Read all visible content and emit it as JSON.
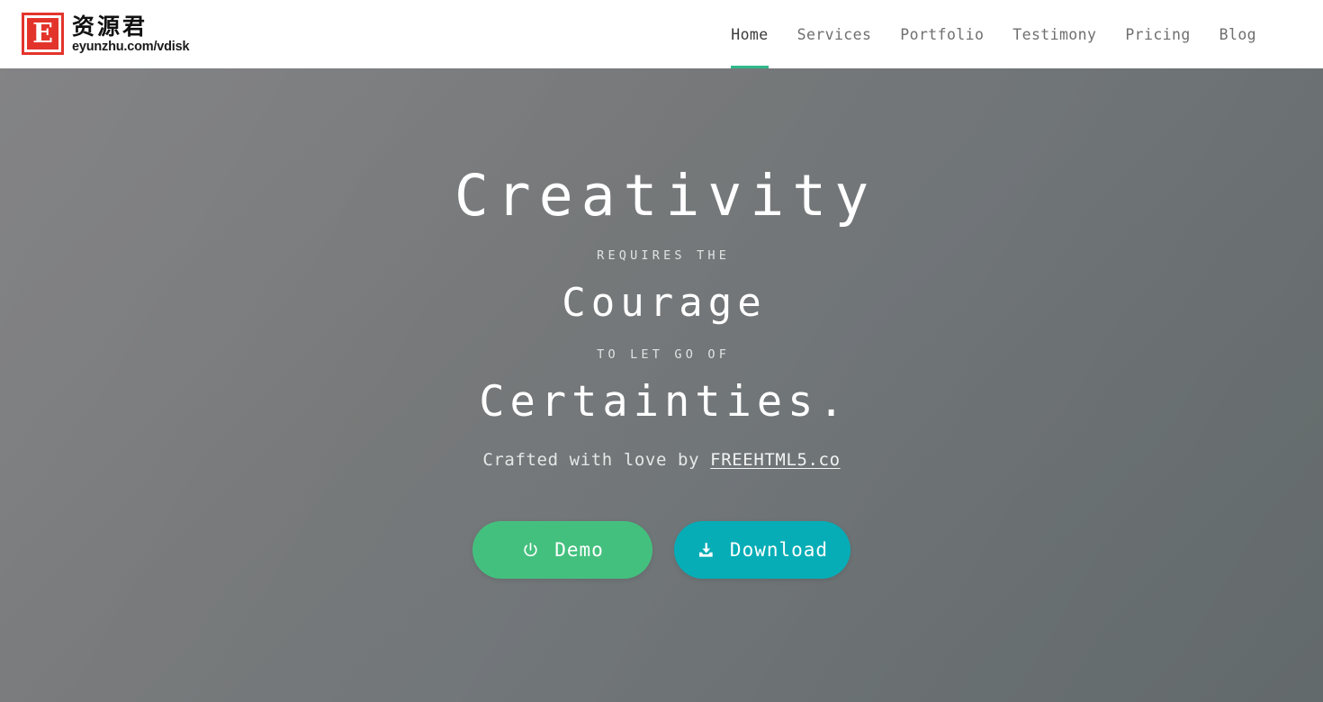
{
  "header": {
    "brand": {
      "mark_letter": "E",
      "name_cn": "资源君",
      "url": "eyunzhu.com/vdisk",
      "mark_color": "#e3342c"
    },
    "nav": [
      {
        "label": "Home",
        "active": true
      },
      {
        "label": "Services",
        "active": false
      },
      {
        "label": "Portfolio",
        "active": false
      },
      {
        "label": "Testimony",
        "active": false
      },
      {
        "label": "Pricing",
        "active": false
      },
      {
        "label": "Blog",
        "active": false
      }
    ],
    "active_indicator_color": "#2fb98a"
  },
  "hero": {
    "headline": "Creativity",
    "caption_1": "REQUIRES THE",
    "subhead": "Courage",
    "caption_2": "TO LET GO OF",
    "subhead_2": "Certainties.",
    "credit_prefix": "Crafted with love by ",
    "credit_link": "FREEHTML5.co",
    "buttons": [
      {
        "label": "Demo",
        "icon": "power-icon",
        "color": "#44c07e"
      },
      {
        "label": "Download",
        "icon": "download-icon",
        "color": "#06adb6"
      }
    ],
    "background": {
      "from": "#7e7e80",
      "to": "#697072"
    }
  }
}
